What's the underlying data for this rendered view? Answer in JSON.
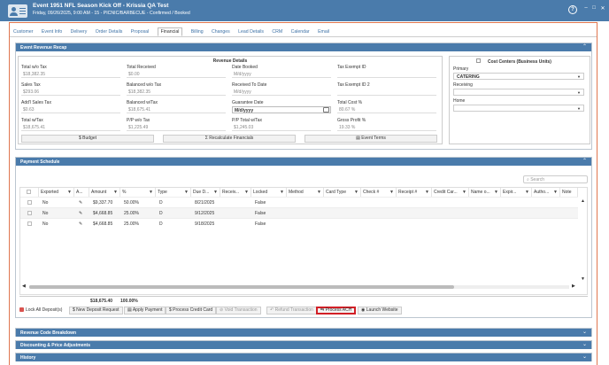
{
  "header": {
    "title": "Event 1951 NFL Season Kick Off - Krissia QA Test",
    "subtitle": "Friday, 09/26/2025, 9:00 AM - 15 - PICNIC/BARBECUE - Confirmed / Booked",
    "help": "?",
    "minimize": "–",
    "maximize": "□",
    "close": "✕"
  },
  "tabs": [
    "Customer",
    "Event Info",
    "Delivery",
    "Order Details",
    "Proposal",
    "Financial",
    "Billing",
    "Changes",
    "Lead Details",
    "CRM",
    "Calendar",
    "Email"
  ],
  "active_tab": "Financial",
  "recap": {
    "header": "Event Revenue Recap",
    "box_title": "Revenue Details",
    "fields": {
      "total_wo_tax": {
        "label": "Total w/o Tax",
        "value": "$18,382.35"
      },
      "total_received": {
        "label": "Total Received",
        "value": "$0.00"
      },
      "date_booked": {
        "label": "Date Booked",
        "value": "M/d/yyyy"
      },
      "tax_exempt_id": {
        "label": "Tax Exempt ID",
        "value": ""
      },
      "sales_tax": {
        "label": "Sales Tax",
        "value": "$293.06"
      },
      "balanced_wo_tax": {
        "label": "Balanced w/o Tax",
        "value": "$18,382.35"
      },
      "received_to_date": {
        "label": "Received To Date",
        "value": "M/d/yyyy"
      },
      "tax_exempt_id2": {
        "label": "Tax Exempt ID 2",
        "value": ""
      },
      "addl_sales_tax": {
        "label": "Add'l Sales Tax",
        "value": "$0.63"
      },
      "balanced_w_tax": {
        "label": "Balanced w/Tax",
        "value": "$18,675.41"
      },
      "guarantee_date": {
        "label": "Guarantee Date",
        "value": "M/d/yyyy"
      },
      "total_cost_pct": {
        "label": "Total Cost %",
        "value": "80.67 %"
      },
      "total_w_tax": {
        "label": "Total w/Tax",
        "value": "$18,675.41"
      },
      "pp_wo_tax": {
        "label": "P/P w/o Tax",
        "value": "$1,225.49"
      },
      "pp_total_w_tax": {
        "label": "P/P Total w/Tax",
        "value": "$1,245.03"
      },
      "gross_profit_pct": {
        "label": "Gross Profit %",
        "value": "19.33 %"
      }
    },
    "buttons": {
      "budget": "Budget",
      "recalc": "Recalculate Financials",
      "event_terms": "Event Terms"
    }
  },
  "cost_centers": {
    "title": "Cost Centers (Business Units)",
    "primary_label": "Primary",
    "primary_value": "CATERING",
    "receiving_label": "Receiving",
    "receiving_value": "",
    "home_label": "Home",
    "home_value": ""
  },
  "payment": {
    "header": "Payment Schedule",
    "search_placeholder": "Search",
    "columns": [
      "Exported",
      "A...",
      "Amount",
      "%",
      "Type",
      "Due D...",
      "Receiv...",
      "Locked",
      "Method",
      "Card Type",
      "Check #",
      "Receipt #",
      "Credit Car...",
      "Name o...",
      "Expir...",
      "Autho...",
      "Note"
    ],
    "rows": [
      {
        "exported": "No",
        "amount": "$9,337.70",
        "pct": "50.00%",
        "type": "D",
        "due": "8/21/2025",
        "locked": "False"
      },
      {
        "exported": "No",
        "amount": "$4,668.85",
        "pct": "25.00%",
        "type": "D",
        "due": "9/12/2025",
        "locked": "False"
      },
      {
        "exported": "No",
        "amount": "$4,668.85",
        "pct": "25.00%",
        "type": "D",
        "due": "9/18/2025",
        "locked": "False"
      }
    ],
    "total_amount": "$18,675.40",
    "total_pct": "100.00%",
    "lock_label": "Lock All Deposit(s)",
    "actions": {
      "new_deposit": "New Deposit Request",
      "apply_payment": "Apply Payment",
      "process_cc": "Process Credit Card",
      "void": "Void Transaction",
      "refund": "Refund Transaction",
      "ach": "Process ACH",
      "website": "Launch Website"
    }
  },
  "collapsed_sections": [
    "Revenue Code Breakdown",
    "Discounting & Price Adjustments",
    "History"
  ],
  "colors": {
    "header_blue": "#4a7bab",
    "highlight_red": "#d21f26",
    "border_orange": "#e0764f"
  }
}
